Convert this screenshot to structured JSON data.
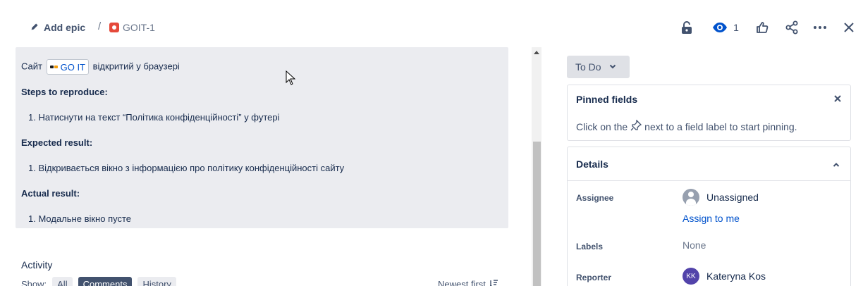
{
  "header": {
    "add_epic_label": "Add epic",
    "separator": "/",
    "issue_key": "GOIT-1",
    "watch_count": "1"
  },
  "description": {
    "intro_prefix": "Сайт",
    "link_text": "GO IT",
    "intro_suffix": "відкритий у браузері",
    "steps_heading": "Steps to reproduce:",
    "steps_item": "1. Натиснути на текст “Політика конфіденційності” у футері",
    "expected_heading": "Expected result:",
    "expected_item": "1. Відкривається вікно з інформацією про політику конфіденційності сайту",
    "actual_heading": "Actual result:",
    "actual_item": "1. Модальне вікно пусте"
  },
  "activity": {
    "title": "Activity",
    "show_label": "Show:",
    "filters": [
      "All",
      "Comments",
      "History"
    ],
    "active_filter": "Comments",
    "sort_label": "Newest first"
  },
  "status": {
    "label": "To Do"
  },
  "pinned": {
    "title": "Pinned fields",
    "hint_prefix": "Click on the",
    "hint_suffix": "next to a field label to start pinning."
  },
  "details": {
    "title": "Details",
    "assignee_label": "Assignee",
    "assignee_value": "Unassigned",
    "assign_to_me": "Assign to me",
    "labels_label": "Labels",
    "labels_value": "None",
    "reporter_label": "Reporter",
    "reporter_initials": "KK",
    "reporter_value": "Kateryna Kos"
  },
  "colors": {
    "brand_link": "#0052cc",
    "bug_icon": "#e5493a",
    "description_bg": "#ebecf0",
    "reporter_avatar": "#5243aa"
  }
}
